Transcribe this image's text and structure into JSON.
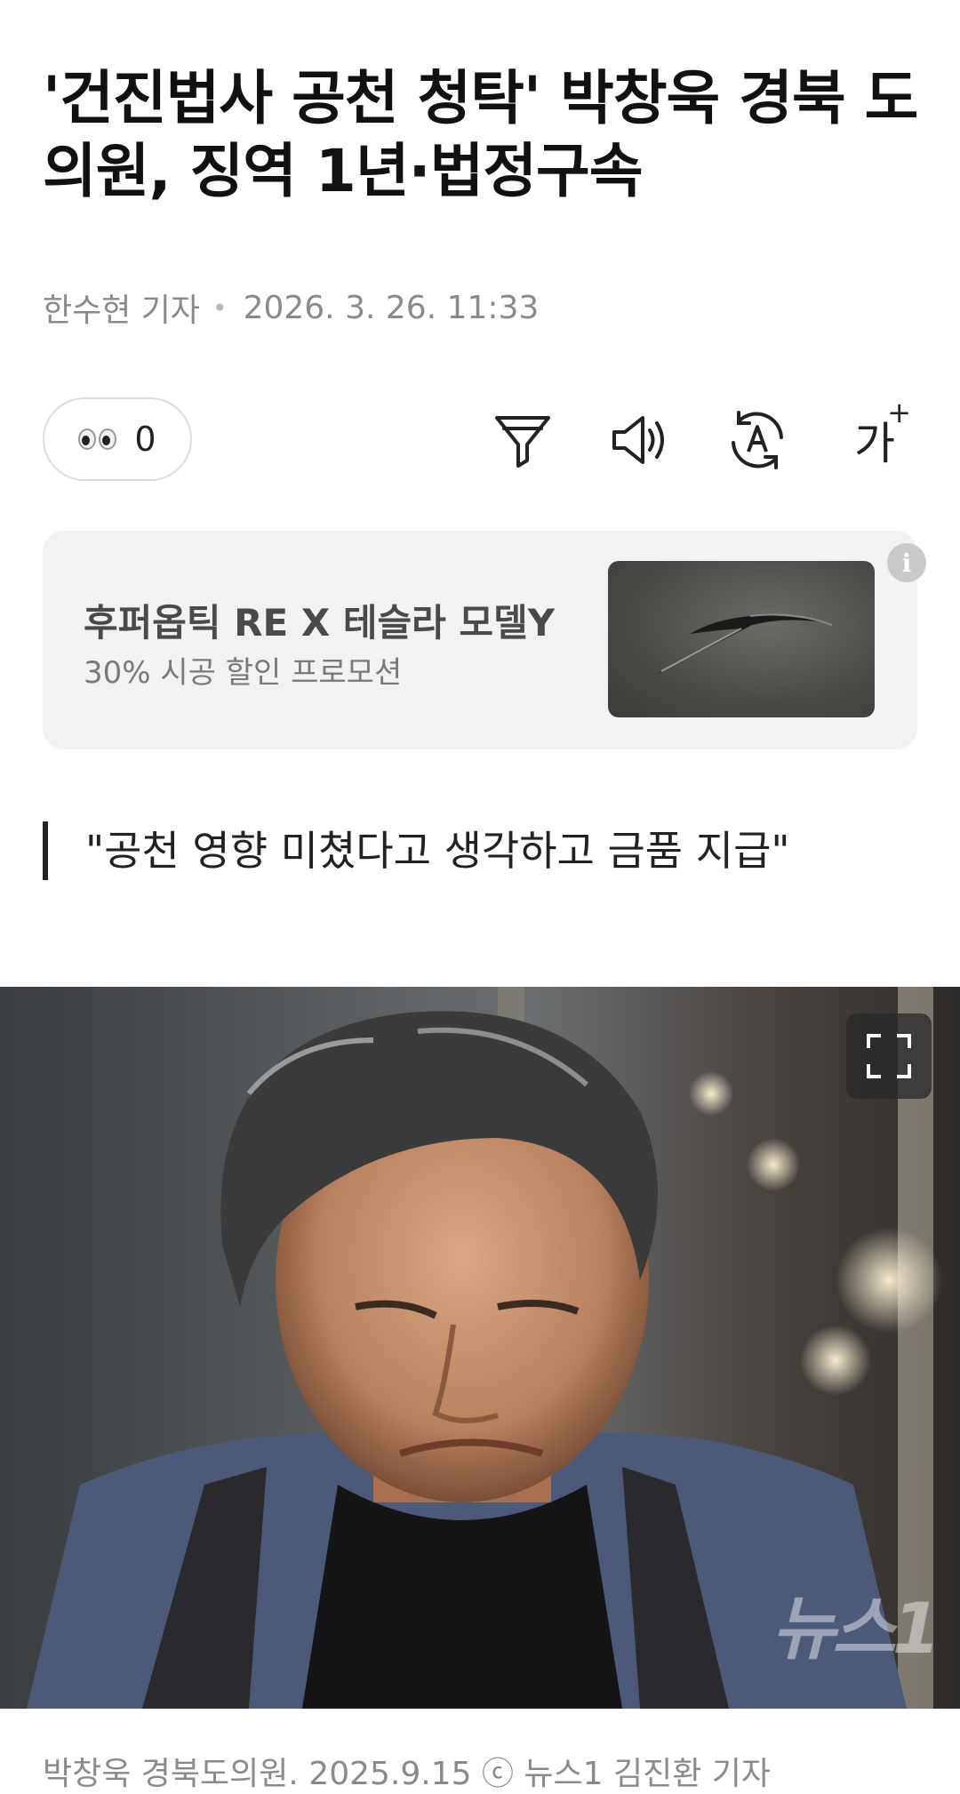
{
  "article": {
    "title": "'건진법사 공천 청탁' 박창욱 경북 도의원, 징역 1년·법정구속",
    "reporter": "한수현 기자",
    "date": "2026. 3. 26. 11:33",
    "subheadline": "\"공천 영향 미쳤다고 생각하고 금품 지급\""
  },
  "reaction": {
    "icon": "eyes-emoji-icon",
    "count": "0"
  },
  "toolbar": {
    "icons": [
      "filter-icon",
      "speaker-icon",
      "translate-icon",
      "font-size-icon"
    ],
    "font_label": "가",
    "font_plus": "+"
  },
  "ad": {
    "title": "후퍼옵틱 RE X 테슬라 모델Y",
    "subtitle": "30% 시공 할인 프로모션",
    "info": "i"
  },
  "photo": {
    "watermark": "뉴스1",
    "caption": "박창욱 경북도의원. 2025.9.15 ⓒ 뉴스1 김진환 기자"
  }
}
